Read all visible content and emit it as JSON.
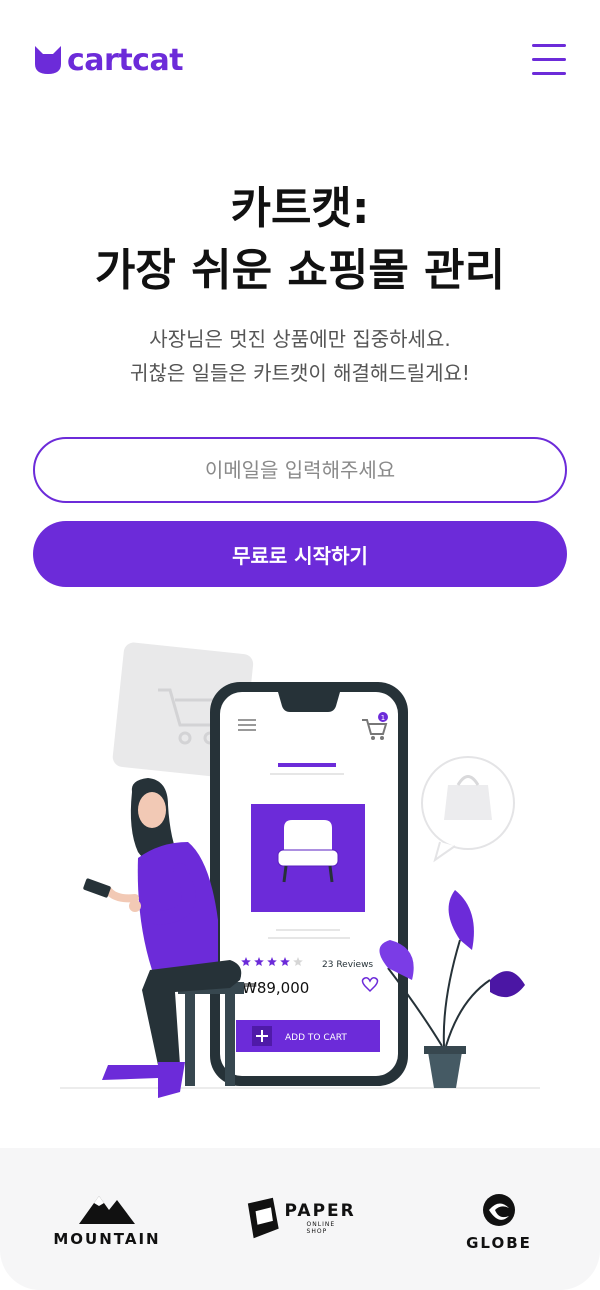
{
  "brand": {
    "name": "cartcat",
    "color": "#6c2bd9"
  },
  "header": {
    "menu_icon": "hamburger-menu-icon"
  },
  "hero": {
    "title_line1": "카트캣:",
    "title_line2": "가장 쉬운 쇼핑몰 관리",
    "subtitle_line1": "사장님은 멋진 상품에만 집중하세요.",
    "subtitle_line2": "귀찮은 일들은 카트캣이 해결해드릴게요!"
  },
  "signup": {
    "email_placeholder": "이메일을 입력해주세요",
    "cta_label": "무료로 시작하기"
  },
  "phone_mockup": {
    "cart_badge": "1",
    "reviews": "23 Reviews",
    "rating": 4,
    "rating_max": 5,
    "price": "₩89,000",
    "add_to_cart": "ADD TO CART"
  },
  "partners": [
    {
      "name": "MOUNTAIN",
      "icon": "mountain-logo-icon"
    },
    {
      "name": "PAPER",
      "tagline": "ONLINE SHOP",
      "icon": "paper-logo-icon"
    },
    {
      "name": "GLOBE",
      "icon": "globe-logo-icon"
    }
  ]
}
